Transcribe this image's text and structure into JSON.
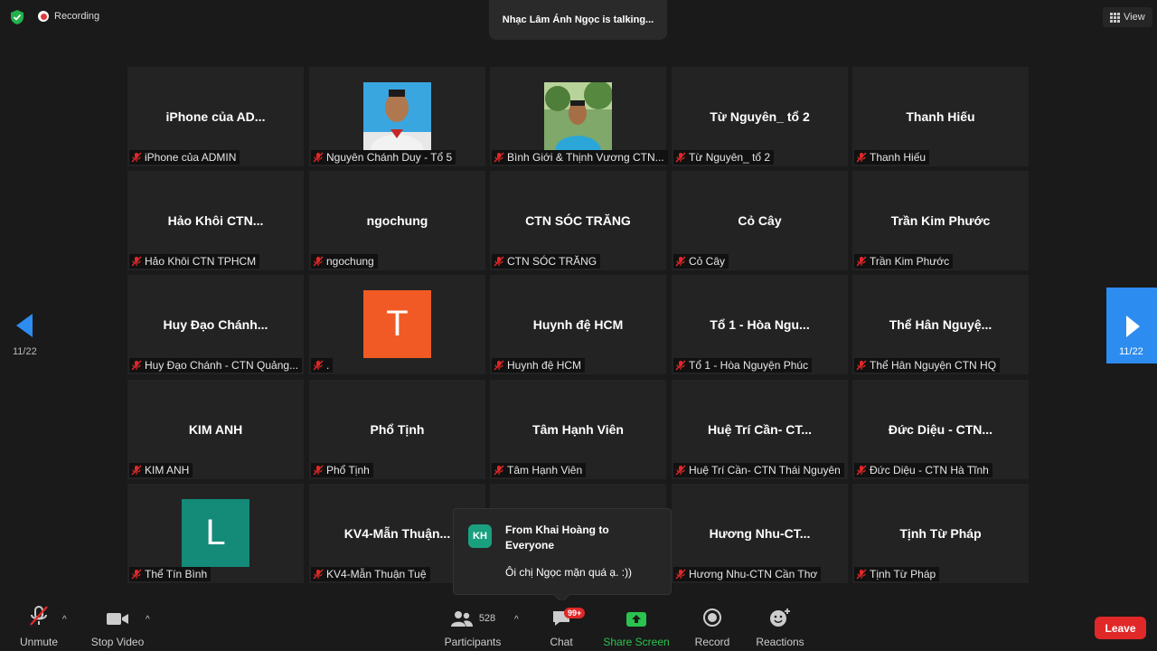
{
  "top": {
    "recording": "Recording",
    "talking": "Nhạc Lâm Ánh Ngọc is talking...",
    "view": "View"
  },
  "pages": {
    "left": "11/22",
    "right": "11/22"
  },
  "tiles": [
    {
      "big": "iPhone của AD...",
      "label": "iPhone của ADMIN"
    },
    {
      "big": "",
      "label": "Nguyên Chánh Duy - Tổ 5"
    },
    {
      "big": "",
      "label": "Bình Giới & Thịnh Vương CTN..."
    },
    {
      "big": "Từ Nguyên_ tổ 2",
      "label": "Từ Nguyên_ tổ 2"
    },
    {
      "big": "Thanh Hiếu",
      "label": "Thanh Hiếu"
    },
    {
      "big": "Hảo Khôi  CTN...",
      "label": "Hảo Khôi  CTN TPHCM"
    },
    {
      "big": "ngochung",
      "label": "ngochung"
    },
    {
      "big": "CTN SÓC TRĂNG",
      "label": "CTN SÓC TRĂNG"
    },
    {
      "big": "Cỏ Cây",
      "label": "Cỏ Cây"
    },
    {
      "big": "Trần  Kim Phước",
      "label": "Trần  Kim Phước"
    },
    {
      "big": "Huy  Đạo  Chánh...",
      "label": "Huy Đạo Chánh - CTN Quảng..."
    },
    {
      "big": "",
      "label": "."
    },
    {
      "big": "Huynh đệ HCM",
      "label": "Huynh đệ HCM"
    },
    {
      "big": "Tổ 1 - Hòa Ngu...",
      "label": "Tổ 1 - Hòa Nguyện Phúc"
    },
    {
      "big": "Thể Hân  Nguyệ...",
      "label": "Thể Hân Nguyện CTN HQ"
    },
    {
      "big": "KIM ANH",
      "label": "KIM ANH"
    },
    {
      "big": "Phổ Tịnh",
      "label": "Phổ Tịnh"
    },
    {
      "big": "Tâm Hạnh Viên",
      "label": "Tâm Hạnh Viên"
    },
    {
      "big": "Huệ Trí Cần- CT...",
      "label": "Huệ Trí Cần- CTN Thái Nguyên"
    },
    {
      "big": "Đức Diệu - CTN...",
      "label": "Đức Diệu - CTN Hà Tĩnh"
    },
    {
      "big": "",
      "label": "Thể Tín Bình"
    },
    {
      "big": "KV4-Mẫn  Thuận...",
      "label": "KV4-Mẫn Thuận Tuệ"
    },
    {
      "big": "",
      "label": ""
    },
    {
      "big": "Hương  Nhu-CT...",
      "label": "Hương Nhu-CTN Cần Thơ"
    },
    {
      "big": "Tịnh Từ Pháp",
      "label": "Tịnh Từ Pháp"
    }
  ],
  "avatars": {
    "t": "T",
    "l": "L"
  },
  "colors": {
    "avatar_t": "#f15a24",
    "avatar_l": "#148a78",
    "accent": "#2d8cf0",
    "leave": "#e02828"
  },
  "chat_popup": {
    "initials": "KH",
    "from": "From Khai Hoàng to Everyone",
    "message": "Ôi chị Ngọc mặn quá ạ. :))"
  },
  "toolbar": {
    "unmute": "Unmute",
    "stop_video": "Stop Video",
    "participants_count": "528",
    "participants": "Participants",
    "chat": "Chat",
    "chat_badge": "99+",
    "share_screen": "Share Screen",
    "record": "Record",
    "reactions": "Reactions",
    "leave": "Leave"
  }
}
